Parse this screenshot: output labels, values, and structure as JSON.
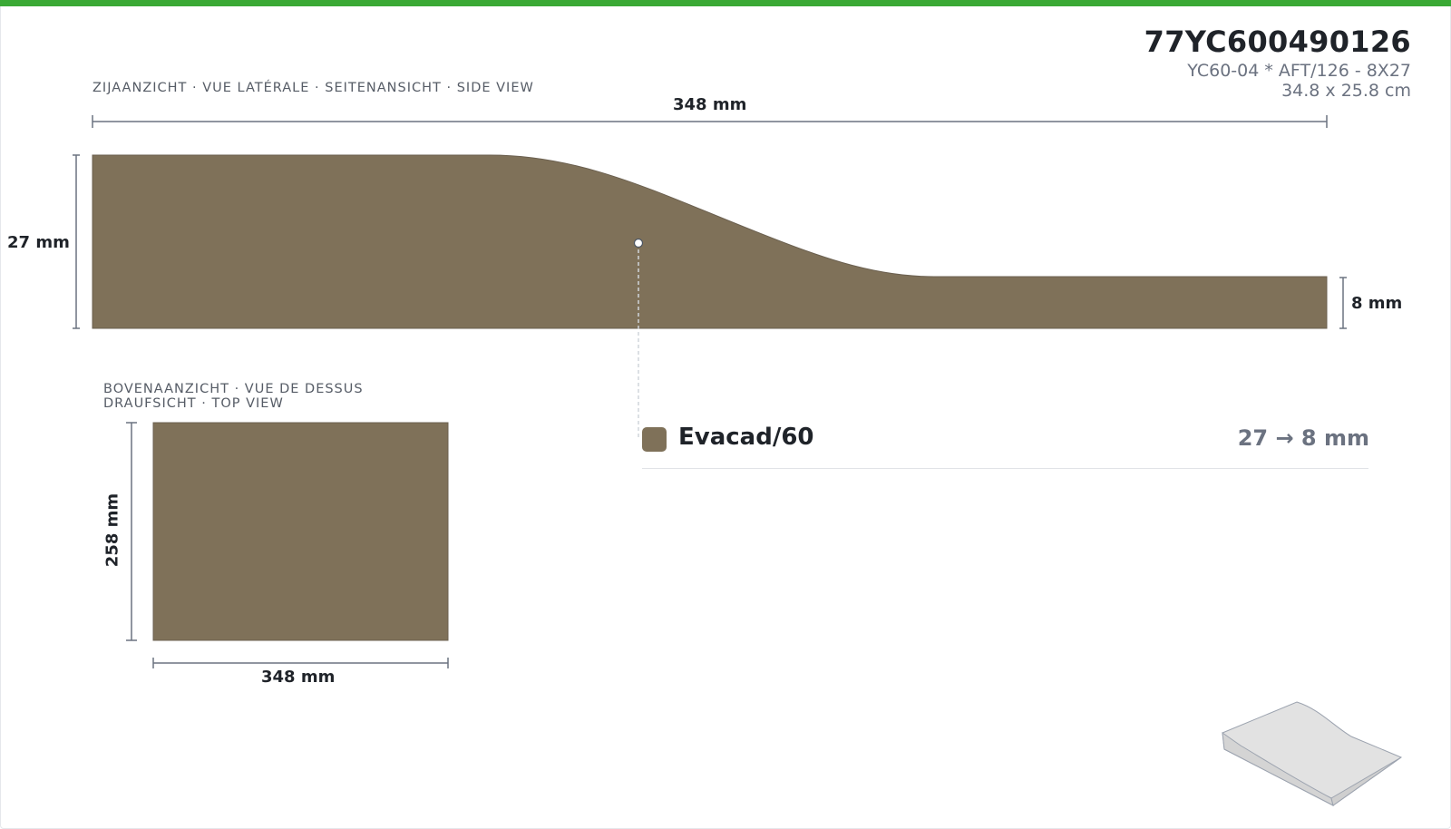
{
  "product": {
    "code": "77YC600490126",
    "description": "YC60-04 * AFT/126 - 8X27",
    "size": "34.8 x 25.8 cm"
  },
  "side_view": {
    "label": "ZIJAANZICHT · VUE LATÉRALE · SEITENANSICHT · SIDE VIEW",
    "width_label": "348 mm",
    "height_start_label": "27 mm",
    "height_end_label": "8 mm"
  },
  "top_view": {
    "label_line1": "BOVENAANZICHT · VUE DE DESSUS",
    "label_line2": "DRAUFSICHT · TOP VIEW",
    "width_label": "348 mm",
    "height_label": "258 mm"
  },
  "material": {
    "name": "Evacad/60",
    "thickness_range": "27 → 8 mm",
    "color": "#7f7159"
  },
  "colors": {
    "accent_bar": "#3aa935",
    "material": "#7f7159",
    "dimension_line": "#6b7280"
  },
  "icons": {
    "preview": "isometric-wedge-icon"
  }
}
